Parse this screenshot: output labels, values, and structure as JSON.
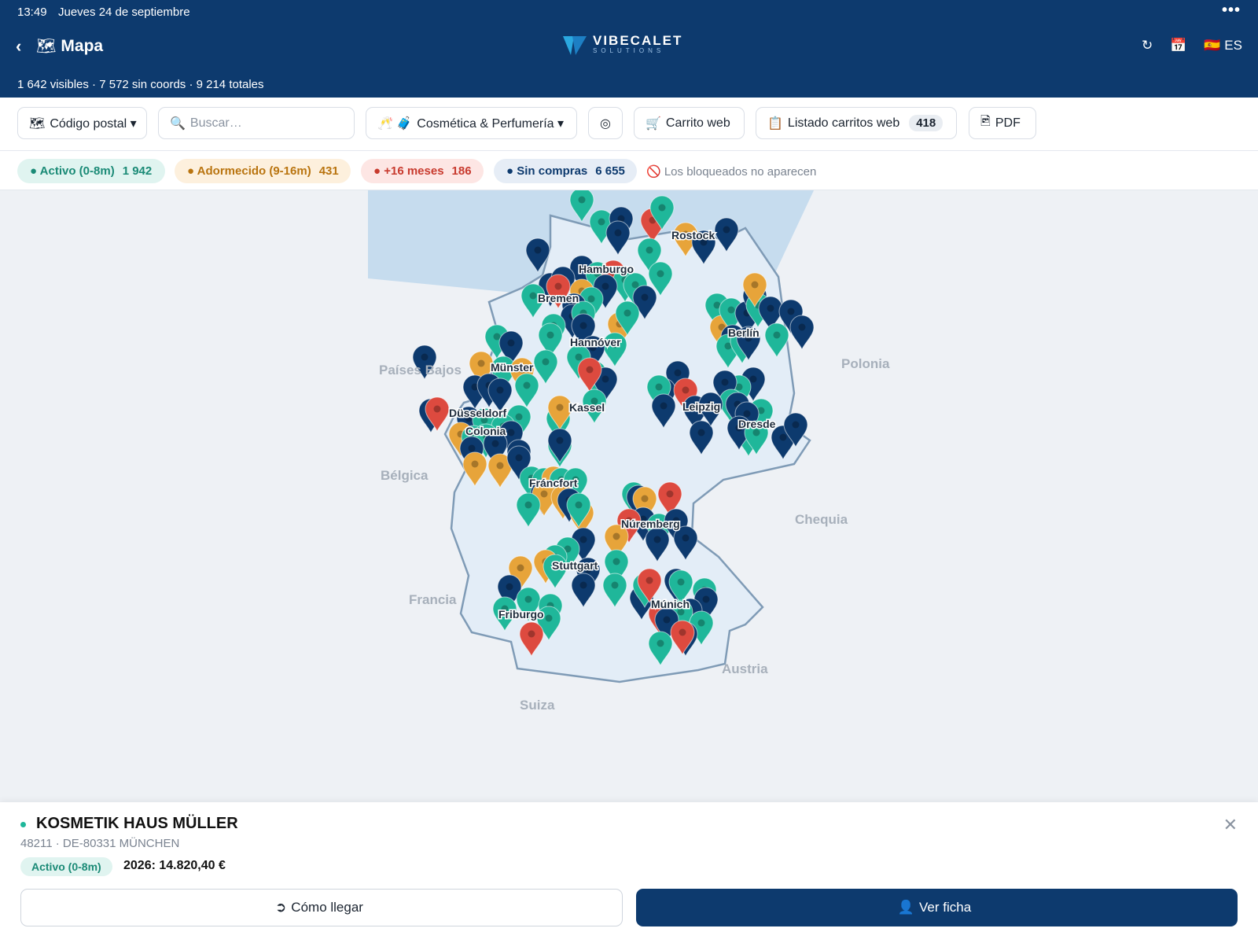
{
  "status_bar": {
    "time": "13:49",
    "date": "Jueves 24 de septiembre",
    "more": "•••"
  },
  "header": {
    "back": "‹",
    "title_icon": "🗺",
    "title": "Mapa",
    "logo_name": "VIBECALET",
    "logo_sub": "SOLUTIONS",
    "refresh": "↻",
    "calendar": "📅",
    "language": "🇪🇸 ES",
    "counts": "1 642 visibles · 7 572 sin coords · 9 214 totales"
  },
  "toolbar": {
    "postal_icon": "🗺",
    "postal_label": "Código postal ▾",
    "search_icon": "🔍",
    "search_placeholder": "Buscar…",
    "category_icon": "🥂 🧳",
    "category_label": "Cosmética & Perfumería ▾",
    "locate": "◎",
    "cart_icon": "🛒",
    "cart_label": "Carrito web",
    "list_icon": "📋",
    "list_label": "Listado carritos web",
    "list_count": "418",
    "pdf_icon": "🖻",
    "pdf_label": "PDF"
  },
  "status_filters": [
    {
      "label": "● Activo (0-8m)",
      "count": "1 942",
      "color": "#1fb79a"
    },
    {
      "label": "● Adormecido (9-16m)",
      "count": "431",
      "color": "#e7a43a"
    },
    {
      "label": "● +16 meses",
      "count": "186",
      "color": "#dd4a3f"
    },
    {
      "label": "● Sin compras",
      "count": "6 655",
      "color": "#0d3a6e"
    }
  ],
  "blocked_note": "🚫 Los bloqueados no aparecen",
  "map": {
    "countries": [
      "Países Bajos",
      "Bélgica",
      "Francia",
      "Suiza",
      "Austria",
      "Chequia",
      "Polonia"
    ],
    "cities": [
      "Rostock",
      "Hamburgo",
      "Bremen",
      "Hannóver",
      "Berlín",
      "Münster",
      "Kassel",
      "Leipzig",
      "Düsseldorf",
      "Dresde",
      "Colonia",
      "Fráncfort",
      "Núremberg",
      "Stuttgart",
      "Friburgo",
      "Múnich"
    ],
    "marker_colors": {
      "activo": "#1fb79a",
      "adormecido": "#e7a43a",
      "antiguo": "#dd4a3f",
      "sin_compras": "#0d3a6e"
    }
  },
  "detail": {
    "name": "KOSMETIK HAUS MÜLLER",
    "address": "48211 · DE-80331 MÜNCHEN",
    "status": "Activo (0-8m)",
    "sales": "2026: 14.820,40 €",
    "close": "✕",
    "route_icon": "➲",
    "route_label": "Cómo llegar",
    "view_icon": "👤",
    "view_label": "Ver ficha"
  }
}
